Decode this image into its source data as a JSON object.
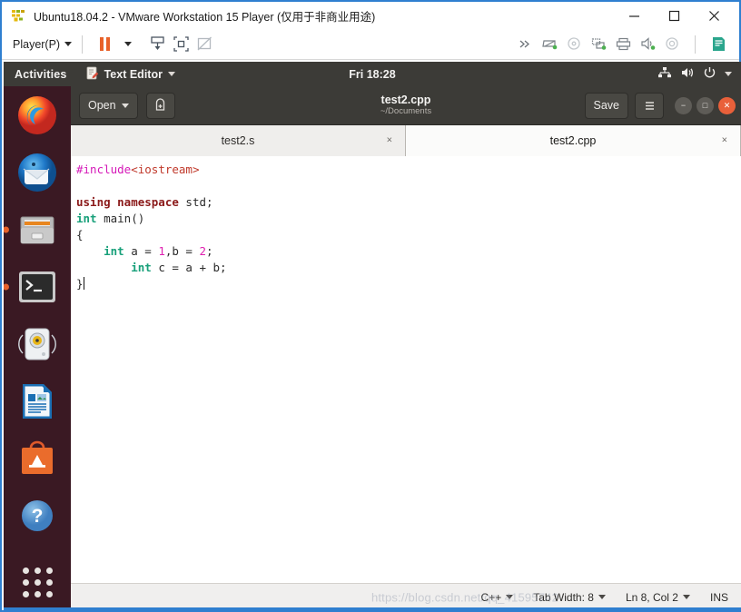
{
  "vmware": {
    "title": "Ubuntu18.04.2 - VMware Workstation 15 Player (仅用于非商业用途)",
    "logo_name": "vmware-logo",
    "window_controls": {
      "minimize": "minimize-icon",
      "maximize": "maximize-icon",
      "close": "close-icon"
    },
    "toolbar": {
      "player_menu": "Player(P)",
      "buttons": [
        {
          "name": "pause-button",
          "label": "pause"
        },
        {
          "name": "pause-dropdown",
          "label": "pause options"
        },
        {
          "name": "send-ctrl-alt-del-button",
          "label": "send ctrl+alt+del"
        },
        {
          "name": "full-screen-button",
          "label": "full screen"
        },
        {
          "name": "unity-mode-button",
          "label": "unity mode"
        }
      ],
      "status_icons": [
        {
          "name": "expand-chevrons-icon",
          "label": "more"
        },
        {
          "name": "hard-disk-icon",
          "label": "hard disk"
        },
        {
          "name": "cd-dvd-icon",
          "label": "cd/dvd"
        },
        {
          "name": "network-adapter-icon",
          "label": "network adapter"
        },
        {
          "name": "printer-icon",
          "label": "printer"
        },
        {
          "name": "sound-card-icon",
          "label": "sound card"
        },
        {
          "name": "usb-icon",
          "label": "usb"
        },
        {
          "name": "message-log-icon",
          "label": "message log"
        }
      ]
    }
  },
  "gnome": {
    "activities": "Activities",
    "app_menu": "Text Editor",
    "app_icon": "text-editor-icon",
    "clock": "Fri 18:28",
    "status_icons": [
      {
        "name": "network-icon",
        "label": "network"
      },
      {
        "name": "volume-icon",
        "label": "volume"
      },
      {
        "name": "power-icon",
        "label": "power"
      },
      {
        "name": "system-menu-arrow-icon",
        "label": "system menu"
      }
    ]
  },
  "dock": {
    "items": [
      {
        "name": "dock-item-firefox",
        "label": "Firefox",
        "running": false
      },
      {
        "name": "dock-item-thunderbird",
        "label": "Thunderbird",
        "running": false
      },
      {
        "name": "dock-item-files",
        "label": "Files",
        "running": true
      },
      {
        "name": "dock-item-terminal",
        "label": "Terminal",
        "running": true
      },
      {
        "name": "dock-item-rhythmbox",
        "label": "Rhythmbox",
        "running": false
      },
      {
        "name": "dock-item-libreoffice-writer",
        "label": "LibreOffice Writer",
        "running": false
      },
      {
        "name": "dock-item-ubuntu-software",
        "label": "Ubuntu Software",
        "running": false
      },
      {
        "name": "dock-item-help",
        "label": "Help",
        "running": false
      }
    ],
    "show_apps_label": "Show Applications"
  },
  "gedit": {
    "open_button": "Open",
    "new_document_icon": "new-document-icon",
    "title": "test2.cpp",
    "subtitle": "~/Documents",
    "save_button": "Save",
    "menu_icon": "hamburger-menu-icon",
    "window_controls": {
      "minimize": "−",
      "maximize": "□",
      "close": "✕"
    },
    "tabs": [
      {
        "label": "test2.s",
        "active": false,
        "close": "×"
      },
      {
        "label": "test2.cpp",
        "active": true,
        "close": "×"
      }
    ],
    "code_lines": [
      [
        {
          "t": "#include",
          "c": "k-pre"
        },
        {
          "t": "<iostream>",
          "c": "k-inc"
        }
      ],
      [],
      [
        {
          "t": "using namespace ",
          "c": "k-kw"
        },
        {
          "t": "std;",
          "c": "k-plain"
        }
      ],
      [
        {
          "t": "int",
          "c": "k-type"
        },
        {
          "t": " main()",
          "c": "k-plain"
        }
      ],
      [
        {
          "t": "{",
          "c": "k-plain"
        }
      ],
      [
        {
          "t": "    ",
          "c": "k-plain"
        },
        {
          "t": "int",
          "c": "k-type"
        },
        {
          "t": " a = ",
          "c": "k-plain"
        },
        {
          "t": "1",
          "c": "k-num"
        },
        {
          "t": ",b = ",
          "c": "k-plain"
        },
        {
          "t": "2",
          "c": "k-num"
        },
        {
          "t": ";",
          "c": "k-plain"
        }
      ],
      [
        {
          "t": "        ",
          "c": "k-plain"
        },
        {
          "t": "int",
          "c": "k-type"
        },
        {
          "t": " c = a + b;",
          "c": "k-plain"
        }
      ],
      [
        {
          "t": "}",
          "c": "k-plain"
        }
      ]
    ],
    "statusbar": {
      "language": "C++",
      "tab_width": "Tab Width: 8",
      "position": "Ln 8, Col 2",
      "insert_mode": "INS",
      "watermark": "https://blog.csdn.net/qq_41595742"
    }
  },
  "colors": {
    "vmware_accent": "#2f7fd0",
    "ubuntu_purple": "#2c001e",
    "gnome_bar": "#3c3b37",
    "orange_accent": "#e8622a",
    "close_red": "#e9603a"
  }
}
